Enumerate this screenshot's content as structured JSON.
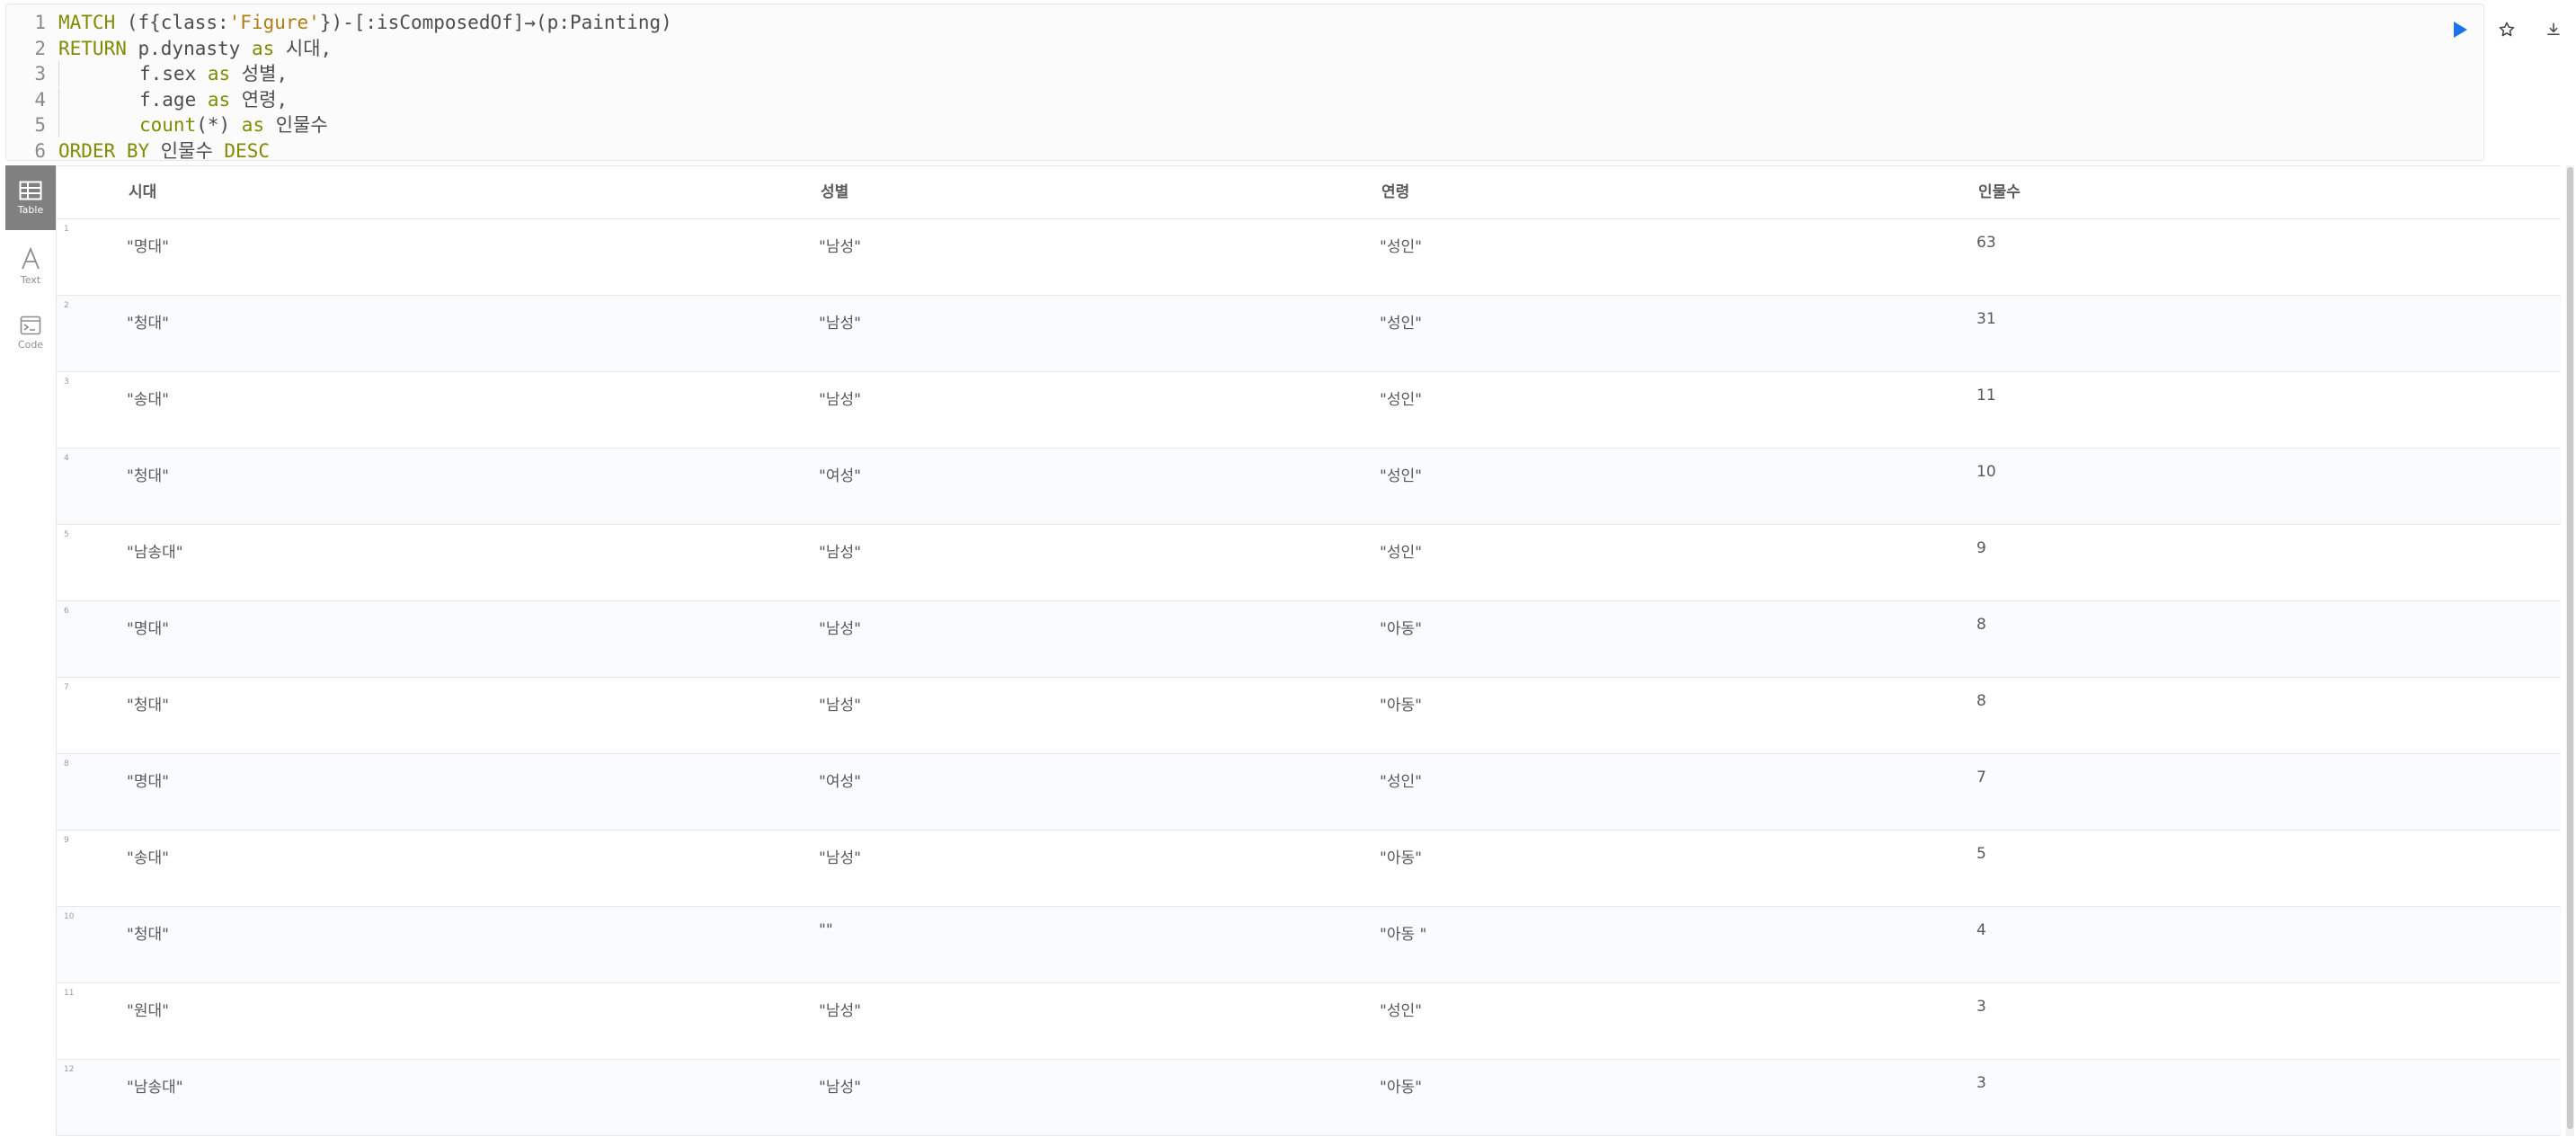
{
  "editor": {
    "lines": [
      {
        "num": "1",
        "parts": [
          {
            "t": "MATCH",
            "c": "kw"
          },
          {
            "t": " (f{class:"
          },
          {
            "t": "'Figure'",
            "c": "str"
          },
          {
            "t": "})-[:isComposedOf]→(p:Painting)"
          }
        ]
      },
      {
        "num": "2",
        "parts": [
          {
            "t": "RETURN",
            "c": "kw"
          },
          {
            "t": " p.dynasty "
          },
          {
            "t": "as",
            "c": "kw"
          },
          {
            "t": " 시대,"
          }
        ]
      },
      {
        "num": "3",
        "indent": true,
        "parts": [
          {
            "t": "f.sex "
          },
          {
            "t": "as",
            "c": "kw"
          },
          {
            "t": " 성별,"
          }
        ]
      },
      {
        "num": "4",
        "indent": true,
        "parts": [
          {
            "t": "f.age "
          },
          {
            "t": "as",
            "c": "kw"
          },
          {
            "t": " 연령,"
          }
        ]
      },
      {
        "num": "5",
        "indent": true,
        "parts": [
          {
            "t": "count",
            "c": "kw"
          },
          {
            "t": "(*) "
          },
          {
            "t": "as",
            "c": "kw"
          },
          {
            "t": " 인물수"
          }
        ]
      },
      {
        "num": "6",
        "parts": [
          {
            "t": "ORDER BY",
            "c": "kw"
          },
          {
            "t": " 인물수 "
          },
          {
            "t": "DESC",
            "c": "kw"
          }
        ]
      }
    ]
  },
  "toolbar": {
    "run_icon": "play-icon",
    "favorite_icon": "star-icon",
    "download_icon": "download-icon",
    "accent_color": "#1a73e8"
  },
  "sidebar": {
    "items": [
      {
        "label": "Table",
        "icon": "table-icon",
        "active": true
      },
      {
        "label": "Text",
        "icon": "text-icon",
        "active": false
      },
      {
        "label": "Code",
        "icon": "code-icon",
        "active": false
      }
    ]
  },
  "table": {
    "columns": [
      "시대",
      "성별",
      "연령",
      "인물수"
    ],
    "rows": [
      {
        "n": "1",
        "cells": [
          "\"명대\"",
          "\"남성\"",
          "\"성인\"",
          "63"
        ]
      },
      {
        "n": "2",
        "cells": [
          "\"청대\"",
          "\"남성\"",
          "\"성인\"",
          "31"
        ]
      },
      {
        "n": "3",
        "cells": [
          "\"송대\"",
          "\"남성\"",
          "\"성인\"",
          "11"
        ]
      },
      {
        "n": "4",
        "cells": [
          "\"청대\"",
          "\"여성\"",
          "\"성인\"",
          "10"
        ]
      },
      {
        "n": "5",
        "cells": [
          "\"남송대\"",
          "\"남성\"",
          "\"성인\"",
          "9"
        ]
      },
      {
        "n": "6",
        "cells": [
          "\"명대\"",
          "\"남성\"",
          "\"아동\"",
          "8"
        ]
      },
      {
        "n": "7",
        "cells": [
          "\"청대\"",
          "\"남성\"",
          "\"아동\"",
          "8"
        ]
      },
      {
        "n": "8",
        "cells": [
          "\"명대\"",
          "\"여성\"",
          "\"성인\"",
          "7"
        ]
      },
      {
        "n": "9",
        "cells": [
          "\"송대\"",
          "\"남성\"",
          "\"아동\"",
          "5"
        ]
      },
      {
        "n": "10",
        "cells": [
          "\"청대\"",
          "\"\"",
          "\"아동 \"",
          "4"
        ]
      },
      {
        "n": "11",
        "cells": [
          "\"원대\"",
          "\"남성\"",
          "\"성인\"",
          "3"
        ]
      },
      {
        "n": "12",
        "cells": [
          "\"남송대\"",
          "\"남성\"",
          "\"아동\"",
          "3"
        ]
      }
    ]
  }
}
